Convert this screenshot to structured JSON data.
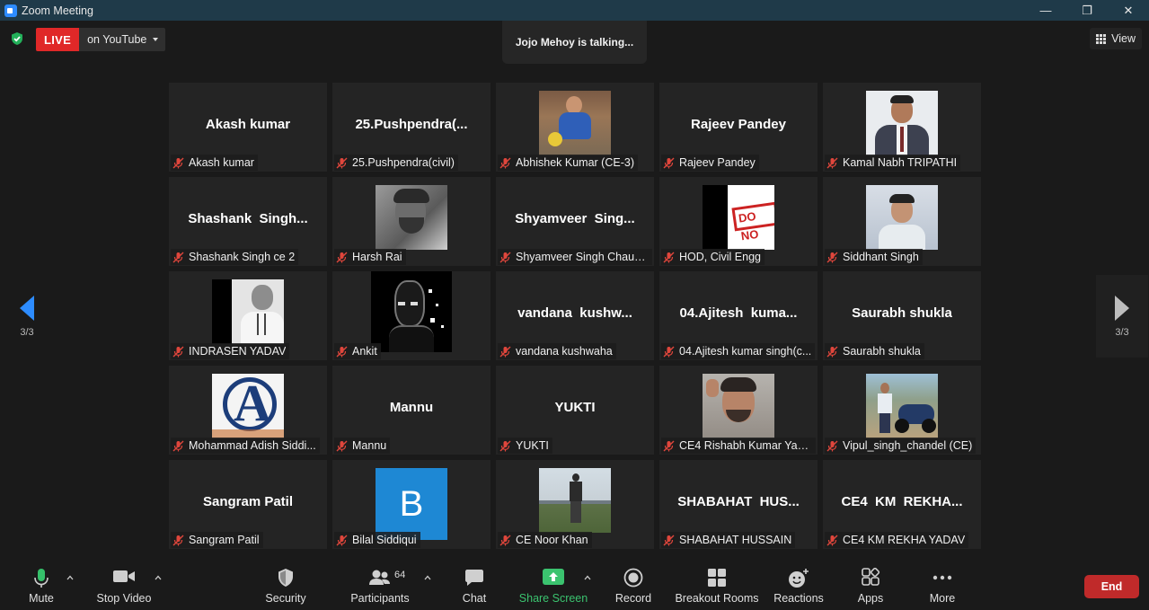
{
  "window": {
    "title": "Zoom Meeting",
    "minimize": "—",
    "maximize": "❐",
    "close": "✕"
  },
  "top": {
    "live_label": "LIVE",
    "live_destination": "on YouTube",
    "talking": "Jojo Mehoy is talking...",
    "view_label": "View"
  },
  "pager": {
    "left_page": "3/3",
    "right_page": "3/3"
  },
  "tiles": [
    {
      "display": "Akash kumar",
      "label": "Akash kumar"
    },
    {
      "display": "25.Pushpendra(...",
      "label": "25.Pushpendra(civil)"
    },
    {
      "display": "",
      "label": "Abhishek Kumar (CE-3)",
      "avatar": "photo-man-blue-shirt"
    },
    {
      "display": "Rajeev Pandey",
      "label": "Rajeev Pandey"
    },
    {
      "display": "",
      "label": "Kamal Nabh TRIPATHI",
      "avatar": "photo-man-suit"
    },
    {
      "display": "Shashank  Singh...",
      "label": "Shashank Singh ce 2"
    },
    {
      "display": "",
      "label": "Harsh Rai",
      "avatar": "photo-grayscale-man"
    },
    {
      "display": "Shyamveer  Sing...",
      "label": "Shyamveer Singh Chauh..."
    },
    {
      "display": "",
      "label": "HOD, Civil Engg",
      "avatar": "do-not-sign",
      "avatar_text": "DO NO"
    },
    {
      "display": "",
      "label": "Siddhant Singh",
      "avatar": "photo-young-man"
    },
    {
      "display": "",
      "label": "INDRASEN YADAV",
      "avatar": "photo-man-lanyard"
    },
    {
      "display": "",
      "label": "Ankit",
      "avatar": "anime-character"
    },
    {
      "display": "vandana  kushw...",
      "label": "vandana kushwaha"
    },
    {
      "display": "04.Ajitesh  kuma...",
      "label": "04.Ajitesh kumar singh(c..."
    },
    {
      "display": "Saurabh shukla",
      "label": "Saurabh shukla"
    },
    {
      "display": "",
      "label": "Mohammad Adish Siddi...",
      "avatar": "avengers-logo",
      "avatar_text": "A"
    },
    {
      "display": "Mannu",
      "label": "Mannu"
    },
    {
      "display": "YUKTI",
      "label": "YUKTI"
    },
    {
      "display": "",
      "label": "CE4 Rishabh Kumar Yad...",
      "avatar": "photo-man-selfie"
    },
    {
      "display": "",
      "label": "Vipul_singh_chandel (CE)",
      "avatar": "photo-man-motorbike"
    },
    {
      "display": "Sangram Patil",
      "label": "Sangram Patil"
    },
    {
      "display": "",
      "label": "Bilal Siddiqui",
      "avatar": "letter-avatar",
      "avatar_text": "B"
    },
    {
      "display": "",
      "label": "CE Noor Khan",
      "avatar": "photo-man-field"
    },
    {
      "display": "SHABAHAT  HUS...",
      "label": "SHABAHAT HUSSAIN"
    },
    {
      "display": "CE4  KM  REKHA...",
      "label": "CE4 KM REKHA YADAV"
    }
  ],
  "toolbar": {
    "mute": "Mute",
    "stop_video": "Stop Video",
    "security": "Security",
    "participants": "Participants",
    "participants_count": "64",
    "chat": "Chat",
    "share_screen": "Share Screen",
    "record": "Record",
    "breakout_rooms": "Breakout Rooms",
    "reactions": "Reactions",
    "apps": "Apps",
    "more": "More",
    "end": "End"
  },
  "colors": {
    "live": "#e02828",
    "share": "#3bc36f",
    "end": "#c02a2a",
    "pager_arrow": "#2d8cff",
    "muted_mic": "#e0463c"
  }
}
